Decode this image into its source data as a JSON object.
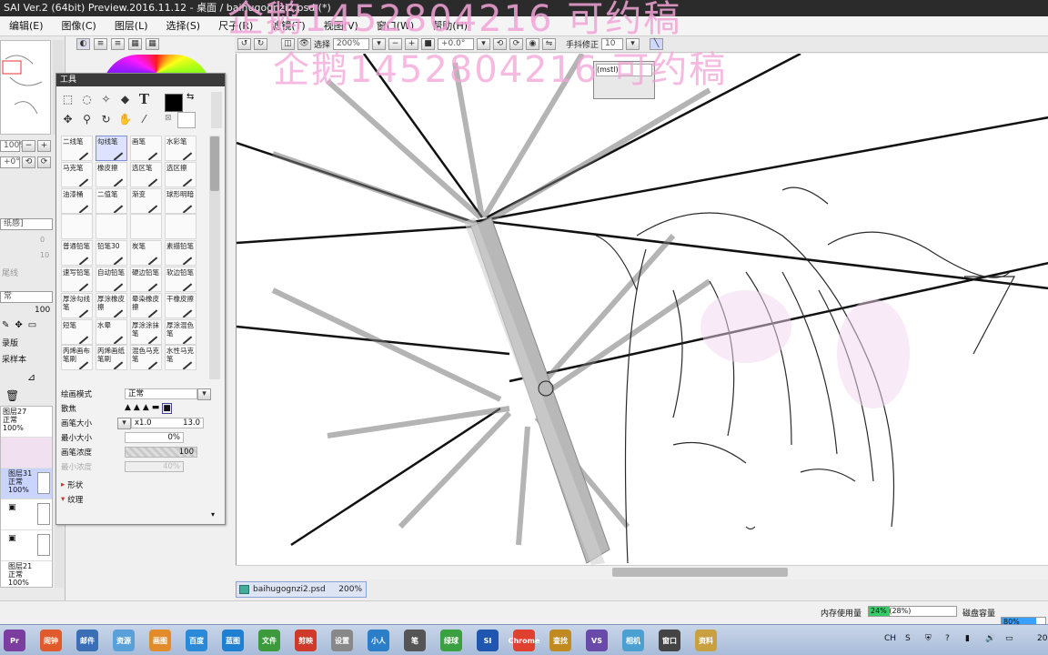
{
  "window": {
    "title": "SAI Ver.2 (64bit) Preview.2016.11.12 - 桌面 / baihugognzi2.psd (*)"
  },
  "menu": [
    "编辑(E)",
    "图像(C)",
    "图层(L)",
    "选择(S)",
    "尺子(R)",
    "滤镜(T)",
    "视图(V)",
    "窗口(W)",
    "帮助(H)"
  ],
  "watermark": {
    "line1": "企鹅1452804216  可约稿",
    "line2": "企鹅1452804216  可约稿"
  },
  "canvas_toolbar": {
    "selection_label": "选择",
    "zoom": "200%",
    "angle": "+0.0°",
    "stabilizer_label": "手抖修正",
    "stabilizer_value": "10"
  },
  "left_strip": {
    "zoom": "100%",
    "angle": "+0°",
    "texture": "纸感]",
    "val1": "0",
    "val2": "10",
    "stroke": "尾线",
    "blend": "常",
    "opacity": "100",
    "item1": "录版",
    "item2": "采样本",
    "layers": [
      {
        "name": "图层27",
        "mode": "正常",
        "opacity": "100%"
      },
      {
        "name": "图层31",
        "mode": "正常",
        "opacity": "100%"
      },
      {
        "name": "图层21",
        "mode": "正常",
        "opacity": "100%"
      }
    ]
  },
  "tools_panel": {
    "title": "工具",
    "brushes": [
      "二线笔",
      "勾线笔",
      "画笔",
      "水彩笔",
      "马克笔",
      "橡皮擦",
      "选区笔",
      "选区擦",
      "油漆桶",
      "二值笔",
      "渐变",
      "球形明暗",
      "",
      "",
      "",
      "",
      "普通铅笔",
      "铅笔30",
      "炭笔",
      "素描铅笔",
      "速写铅笔",
      "自动铅笔",
      "硬边铅笔",
      "软边铅笔",
      "厚涂勾线笔",
      "厚涂橡皮擦",
      "晕染橡皮擦",
      "干橡皮擦",
      "短笔",
      "水晕",
      "厚涂涂抹笔",
      "厚涂混色笔",
      "丙烯画布笔刷",
      "丙烯画纸笔刷",
      "混色马克笔",
      "水性马克笔"
    ],
    "props": {
      "mode_label": "绘画模式",
      "mode_value": "正常",
      "scatter_label": "散焦",
      "size_label": "画笔大小",
      "size_mult": "x1.0",
      "size_value": "13.0",
      "min_size_label": "最小大小",
      "min_size_value": "0%",
      "density_label": "画笔浓度",
      "density_value": "100",
      "min_density_label": "最小浓度",
      "min_density_value": "40%",
      "shape_label": "形状",
      "texture_label": "纹理"
    }
  },
  "popup": {
    "text": "(mstl)"
  },
  "doc_tab": {
    "name": "baihugognzi2.psd",
    "zoom": "200%"
  },
  "status": {
    "memory_label": "内存使用量",
    "memory_value": "24% (28%)",
    "memory_fraction": 0.24,
    "disk_label": "磁盘容量",
    "disk_value": "80%",
    "disk_fraction": 0.8
  },
  "taskbar": {
    "apps": [
      "Pr",
      "闹钟",
      "邮件",
      "资源",
      "画图",
      "百度",
      "蓝图",
      "文件",
      "剪映",
      "设置",
      "小人",
      "笔",
      "绿球",
      "SI",
      "Chrome",
      "查找",
      "VS",
      "相机",
      "窗口",
      "资料"
    ],
    "tray": {
      "lang": "CH",
      "time": "20"
    }
  },
  "colors": {
    "watermark": "#f3a3d7",
    "taskbar": "#a8bbd8",
    "memory_fill": "#33cc66",
    "disk_fill": "#3aa0ff"
  }
}
